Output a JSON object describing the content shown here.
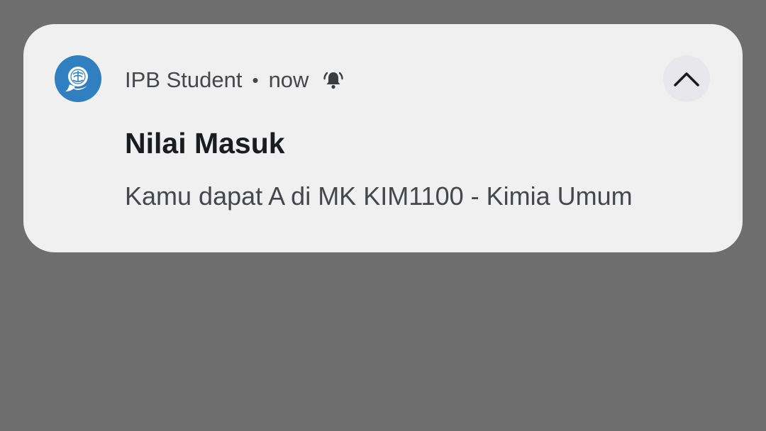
{
  "notification": {
    "app_name": "IPB Student",
    "separator": "•",
    "time": "now",
    "title": "Nilai Masuk",
    "body": "Kamu dapat A di MK KIM1100 - Kimia Umum",
    "icons": {
      "app_icon": "ipb-logo-icon",
      "alert": "bell-ring-icon",
      "collapse": "chevron-up-icon"
    },
    "colors": {
      "card_background": "#f0f0f1",
      "screen_background": "#6e6e6e",
      "app_icon_background": "#2f7fc1"
    }
  }
}
